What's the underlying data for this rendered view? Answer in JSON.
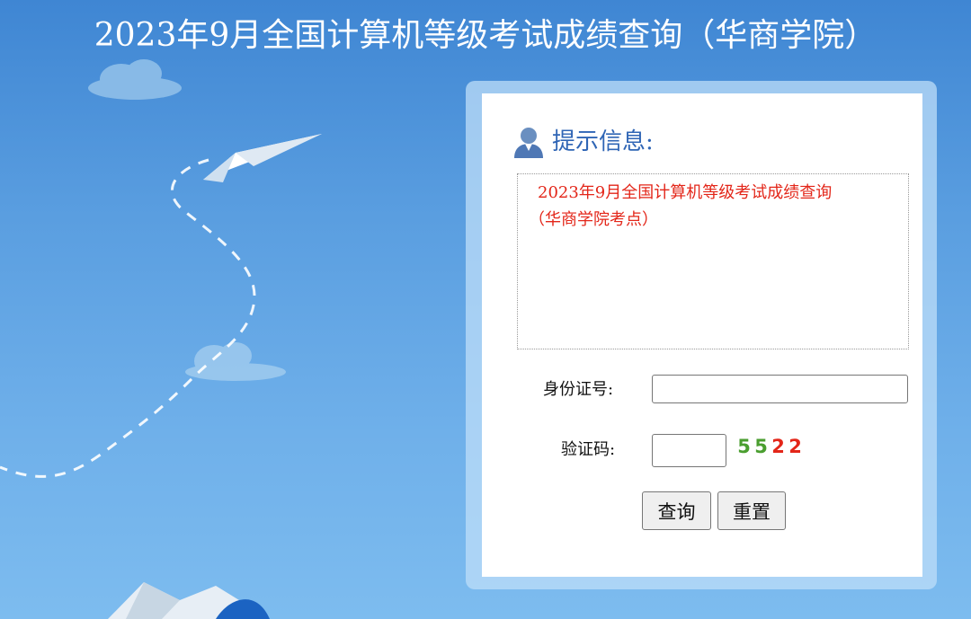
{
  "page": {
    "title": "2023年9月全国计算机等级考试成绩查询（华商学院）"
  },
  "hint": {
    "title": "提示信息:",
    "notice_line1": "2023年9月全国计算机等级考试成绩查询",
    "notice_line2": "（华商学院考点）"
  },
  "form": {
    "id_label": "身份证号:",
    "id_value": "",
    "code_label": "验证码:",
    "code_value": "",
    "captcha_digits": [
      "5",
      "5",
      "2",
      "2"
    ],
    "captcha_colors": [
      "#4a9e2f",
      "#4a9e2f",
      "#e32619",
      "#e32619"
    ]
  },
  "buttons": {
    "query_label": "查询",
    "reset_label": "重置"
  },
  "colors": {
    "title_text": "#ffffff",
    "hint_title": "#2f65b5",
    "notice_text": "#e32619",
    "background": "#5a9ee0"
  }
}
